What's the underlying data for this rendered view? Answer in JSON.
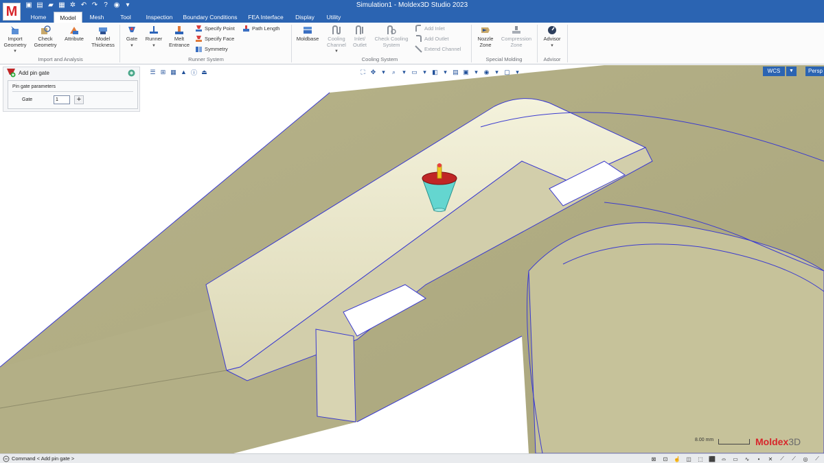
{
  "window": {
    "title": "Simulation1 - Moldex3D Studio 2023",
    "logo_letter": "M"
  },
  "quick_access": [
    "save-icon",
    "save-as-icon",
    "open-folder-icon",
    "search-file-icon",
    "settings-icon",
    "undo-icon",
    "redo-icon",
    "help-icon",
    "camera-icon",
    "more-icon"
  ],
  "tabs": [
    {
      "label": "Home"
    },
    {
      "label": "Model"
    },
    {
      "label": "Mesh"
    },
    {
      "label": "Tool"
    },
    {
      "label": "Inspection"
    },
    {
      "label": "Boundary Conditions"
    },
    {
      "label": "FEA Interface"
    },
    {
      "label": "Display"
    },
    {
      "label": "Utility"
    }
  ],
  "active_tab": "Model",
  "ribbon": {
    "import_analysis": {
      "label": "Import and Analysis",
      "import_l1": "Import",
      "import_l2": "Geometry",
      "check_l1": "Check",
      "check_l2": "Geometry",
      "attribute": "Attribute",
      "thickness_l1": "Model",
      "thickness_l2": "Thickness"
    },
    "runner_system": {
      "label": "Runner System",
      "gate": "Gate",
      "runner": "Runner",
      "melt_l1": "Melt",
      "melt_l2": "Entrance",
      "specify_point": "Specify Point",
      "specify_face": "Specify Face",
      "symmetry": "Symmetry",
      "path_length": "Path Length"
    },
    "cooling_system": {
      "label": "Cooling System",
      "moldbase": "Moldbase",
      "cooling_l1": "Cooling",
      "cooling_l2": "Channel",
      "inlet_l1": "Inlet/",
      "inlet_l2": "Outlet",
      "check_cool_l1": "Check Cooling",
      "check_cool_l2": "System",
      "add_inlet": "Add Inlet",
      "add_outlet": "Add Outlet",
      "extend_channel": "Extend Channel"
    },
    "special_molding": {
      "label": "Special Molding",
      "nozzle_l1": "Nozzle",
      "nozzle_l2": "Zone",
      "compression_l1": "Compression",
      "compression_l2": "Zone"
    },
    "advisor": {
      "label": "Advisor",
      "button": "Advisor"
    }
  },
  "panel": {
    "title": "Add pin gate",
    "section": "Pin gate parameters",
    "gate_label": "Gate",
    "gate_value": "1"
  },
  "view": {
    "wcs": "WCS",
    "projection": "Persp"
  },
  "scale_label": "8.00 mm",
  "brand": {
    "main": "Moldex",
    "suffix": "3D"
  },
  "status": {
    "command": "Command < Add pin gate >"
  },
  "colors": {
    "title_bar": "#2b64b2",
    "part_surface": "#c8c49a",
    "part_light": "#e2dfbf",
    "edge_lines": "#3a3ad0",
    "gate_cone": "#64d6d0",
    "gate_top": "#c02626",
    "gate_pin": "#f0c820",
    "brand_red": "#d7262b"
  }
}
